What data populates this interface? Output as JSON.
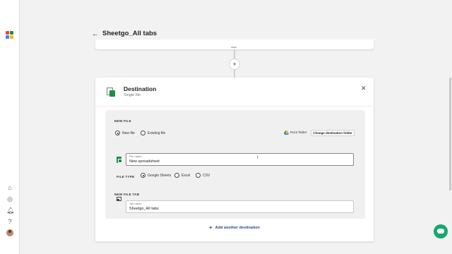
{
  "header": {
    "title": "Sheetgo_All tabs",
    "back_icon": "arrow-left-icon"
  },
  "rail": {
    "icons": [
      "home-icon",
      "compass-icon",
      "bell-icon",
      "help-icon",
      "avatar"
    ],
    "logo_colors": [
      "#e8453c",
      "#1e8e3e",
      "#4285f4",
      "#fbbc04"
    ]
  },
  "destination": {
    "title": "Destination",
    "subtitle": "Single file",
    "new_file_section": "NEW FILE",
    "options": {
      "new_file": "New file",
      "existing_file": "Existing file",
      "selected": "New file"
    },
    "folder_label": "Root folder",
    "change_folder_button": "Change destination folder",
    "file_name": {
      "label": "File name",
      "value": "New spreadsheet"
    },
    "file_type": {
      "label": "FILE TYPE",
      "options": [
        "Google Sheets",
        "Excel",
        "CSV"
      ],
      "selected": "Google Sheets"
    },
    "new_file_tab_section": "NEW FILE TAB",
    "tab_name": {
      "label": "Tab name",
      "value": "Sheetgo_All tabs"
    },
    "add_another": "Add another destination"
  },
  "colors": {
    "accent": "#2a4b8d",
    "sheets_green": "#1e8e3e",
    "chat": "#14a870"
  }
}
